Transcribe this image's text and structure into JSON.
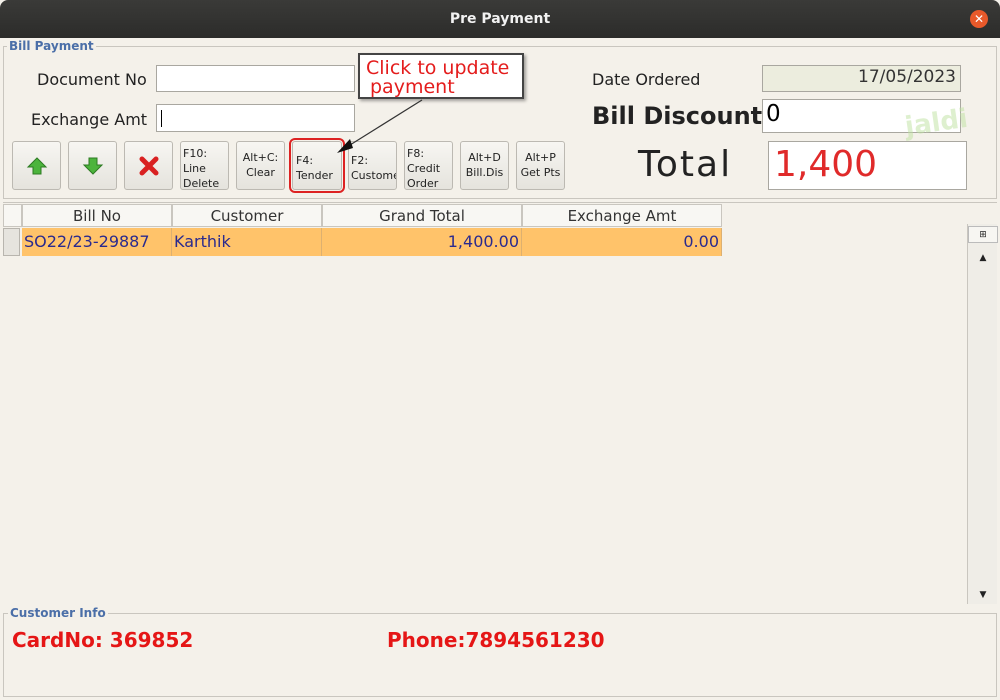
{
  "window": {
    "title": "Pre Payment",
    "close_symbol": "✕"
  },
  "bill_payment": {
    "legend": "Bill Payment",
    "document_no_label": "Document No",
    "document_no_value": "",
    "exchange_amt_label": "Exchange Amt",
    "exchange_amt_value": "",
    "date_ordered_label": "Date Ordered",
    "date_ordered_value": "17/05/2023",
    "bill_discount_label": "Bill Discount",
    "bill_discount_value": "0",
    "total_label": "Total",
    "total_value": "1,400"
  },
  "toolbar": {
    "line_delete": [
      "F10:",
      "Line",
      "Delete"
    ],
    "clear": [
      "Alt+C:",
      "Clear"
    ],
    "tender": [
      "F4:",
      "Tender"
    ],
    "customer": [
      "F2:",
      "Customer"
    ],
    "credit_order": [
      "F8:",
      "Credit",
      "Order"
    ],
    "bill_dis": [
      "Alt+D",
      "Bill.Dis"
    ],
    "get_pts": [
      "Alt+P",
      "Get Pts"
    ]
  },
  "callout": {
    "text_line1": "Click to update",
    "text_line2": "payment"
  },
  "watermark": "jaldi",
  "grid": {
    "columns": [
      "Bill No",
      "Customer",
      "Grand Total",
      "Exchange Amt"
    ],
    "rows": [
      {
        "bill_no": "SO22/23-29887",
        "customer": "Karthik",
        "grand_total": "1,400.00",
        "exchange_amt": "0.00"
      }
    ]
  },
  "customer_info": {
    "legend": "Customer Info",
    "card_no": "CardNo: 369852",
    "phone": "Phone:7894561230"
  },
  "colors": {
    "accent_red": "#e51616",
    "row_highlight": "#ffc36a",
    "legend_blue": "#4b6fa8"
  }
}
